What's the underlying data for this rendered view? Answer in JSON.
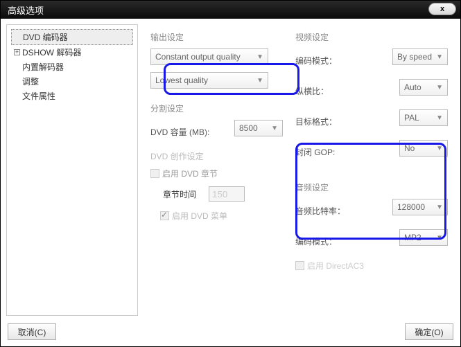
{
  "window": {
    "title": "高级选项",
    "close": "x"
  },
  "sidebar": {
    "items": [
      {
        "label": "DVD 编码器",
        "selected": true
      },
      {
        "label": "DSHOW 解码器",
        "expandable": true
      },
      {
        "label": "内置解码器"
      },
      {
        "label": "调整"
      },
      {
        "label": "文件属性"
      }
    ]
  },
  "output": {
    "section": "输出设定",
    "quality_mode": "Constant output quality",
    "quality_level": "Lowest quality"
  },
  "split": {
    "section": "分割设定",
    "capacity_label": "DVD 容量 (MB):",
    "capacity_value": "8500"
  },
  "authoring": {
    "section": "DVD 创作设定",
    "enable_chapter": "启用 DVD 章节",
    "chapter_time": "章节时间",
    "chapter_value": "150",
    "enable_menu": "启用 DVD 菜单"
  },
  "video": {
    "section": "视频设定",
    "encode_mode_label": "编码模式：",
    "encode_mode_value": "By speed",
    "aspect_label": "纵横比：",
    "aspect_value": "Auto",
    "format_label": "目标格式：",
    "format_value": "PAL",
    "gop_label": "封闭 GOP:",
    "gop_value": "No"
  },
  "audio": {
    "section": "音频设定",
    "bitrate_label": "音频比特率：",
    "bitrate_value": "128000",
    "mode_label": "编码模式：",
    "mode_value": "MP2",
    "directac3": "启用 DirectAC3"
  },
  "footer": {
    "cancel": "取消(C)",
    "ok": "确定(O)"
  }
}
